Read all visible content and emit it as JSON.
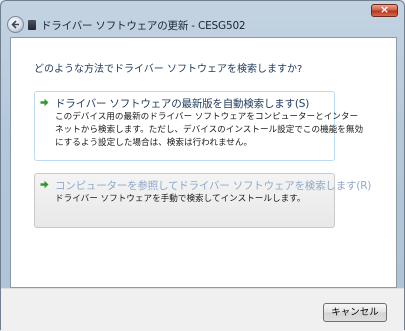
{
  "window": {
    "title": "ドライバー ソフトウェアの更新 - CESG502"
  },
  "content": {
    "prompt": "どのような方法でドライバー ソフトウェアを検索しますか?",
    "options": [
      {
        "title": "ドライバー ソフトウェアの最新版を自動検索します(S)",
        "description_lines": [
          "このデバイス用の最新のドライバー ソフトウェアをコンピューターとインター",
          "ネットから検索します。ただし、デバイスのインストール設定でこの機能を無効",
          "にするよう設定した場合は、検索は行われません。"
        ],
        "icon": "green-arrow-icon"
      },
      {
        "title": "コンピューターを参照してドライバー ソフトウェアを検索します(R)",
        "description_lines": [
          "ドライバー ソフトウェアを手動で検索してインストールします。"
        ],
        "icon": "green-arrow-icon"
      }
    ]
  },
  "footer": {
    "cancel_label": "キャンセル"
  },
  "colors": {
    "link_blue": "#1e395b",
    "link_hover_blue": "#8ea9c9",
    "arrow_green": "#2e9a2e",
    "close_red": "#c8452e"
  }
}
